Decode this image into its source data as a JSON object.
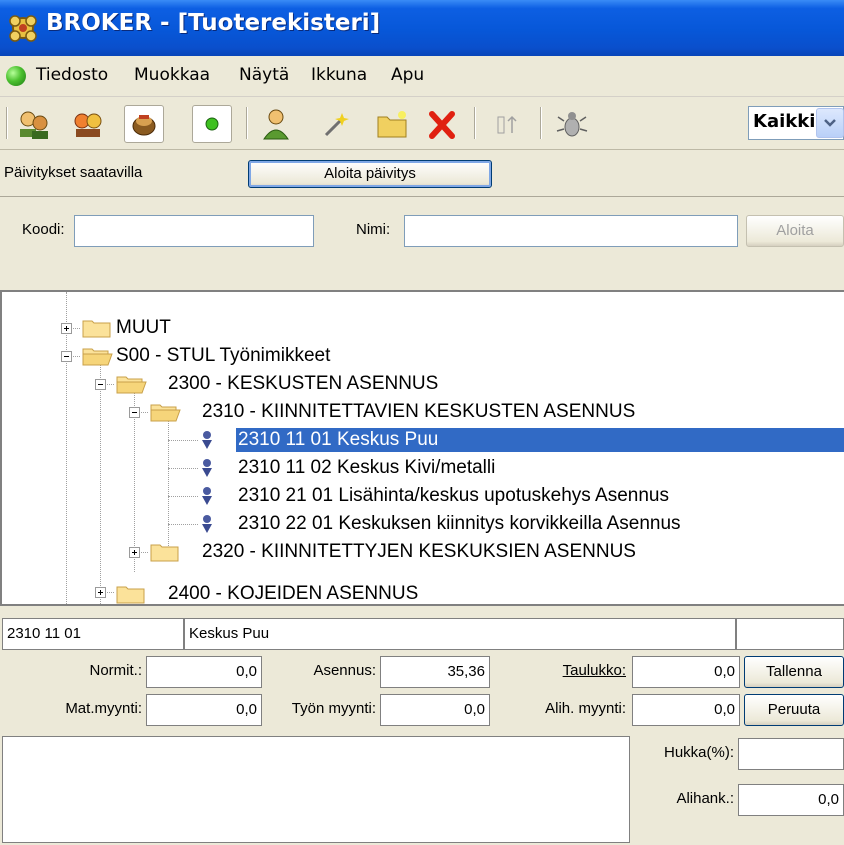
{
  "window": {
    "title": "BROKER - [Tuoterekisteri]"
  },
  "menu": [
    "Tiedosto",
    "Muokkaa",
    "Näytä",
    "Ikkuna",
    "Apu"
  ],
  "toolbar": {
    "filter_value": "Kaikki"
  },
  "updates": {
    "label": "Päivitykset saatavilla",
    "button": "Aloita päivitys"
  },
  "search": {
    "code_label": "Koodi:",
    "code_value": "",
    "name_label": "Nimi:",
    "name_value": "",
    "start_button": "Aloita"
  },
  "tree": {
    "nodes": [
      "MUUT",
      "S00 - STUL Työnimikkeet",
      "2300 - KESKUSTEN ASENNUS",
      "2310 - KIINNITETTAVIEN KESKUSTEN ASENNUS",
      "2310 11 01  Keskus Puu",
      "2310 11 02  Keskus Kivi/metalli",
      "2310 21 01  Lisähinta/keskus upotuskehys Asennus",
      "2310 22 01  Keskuksen kiinnitys korvikkeilla Asennus",
      "2320 - KIINNITETTYJEN KESKUKSIEN ASENNUS",
      "2400 - KOJEIDEN ASENNUS"
    ]
  },
  "details": {
    "code": "2310 11 01",
    "name": "Keskus Puu",
    "normit_label": "Normit.:",
    "normit_value": "0,0",
    "asennus_label": "Asennus:",
    "asennus_value": "35,36",
    "taulukko_label": "Taulukko:",
    "taulukko_value": "0,0",
    "save_button": "Tallenna",
    "mat_label": "Mat.myynti:",
    "mat_value": "0,0",
    "tyon_label": "Työn myynti:",
    "tyon_value": "0,0",
    "alih_label": "Alih. myynti:",
    "alih_value": "0,0",
    "cancel_button": "Peruuta",
    "hukka_label": "Hukka(%):",
    "hukka_value": "",
    "alihank_label": "Alihank.:",
    "alihank_value": "0,0"
  }
}
